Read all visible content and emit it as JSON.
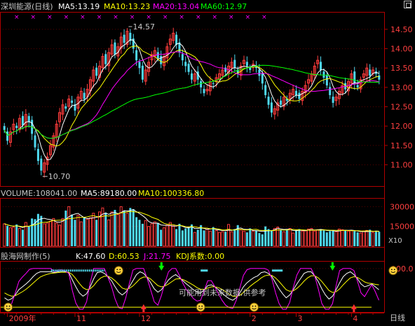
{
  "colors": {
    "bg": "#000000",
    "frame": "#b00000",
    "grid": "#5a0000",
    "up": "#ff3c3c",
    "down": "#4fd9ef",
    "text": "#c8c8c8",
    "ma5": "#ffffff",
    "ma10": "#ffff00",
    "ma20": "#ff00ff",
    "ma60": "#00ff00",
    "k": "#ffffff",
    "d": "#ffff00",
    "j": "#ff00ff",
    "coef": "#ffff00"
  },
  "header": {
    "title": "深圳能源(日线)",
    "ma5": "MA5:13.19",
    "ma10": "MA10:13.23",
    "ma20": "MA20:13.04",
    "ma60": "MA60:12.97"
  },
  "price_annotations": {
    "high": "14.57",
    "low": "10.70"
  },
  "volume_header": {
    "volume": "VOLUME:108041.00",
    "ma5": "MA5:89180.00",
    "ma10": "MA10:100336.80"
  },
  "volume_unit": "X10",
  "kdj_header": {
    "name": "股海网制作(5)",
    "k": "K:47.60",
    "d": "D:60.53",
    "j": "J:21.75",
    "coef": "KDJ系数:0.00"
  },
  "kdj_note": "可能用到未来数据,供参考",
  "period_tab": "日线",
  "chart_data": [
    {
      "type": "candlestick",
      "title": "深圳能源(日线)",
      "y_ticks": [
        11.0,
        11.5,
        12.0,
        12.5,
        13.0,
        13.5,
        14.0,
        14.5
      ],
      "ylim": [
        10.45,
        14.95
      ],
      "close_series": [
        11.9,
        11.62,
        11.85,
        12.05,
        11.95,
        12.2,
        12.02,
        12.3,
        12.1,
        11.8,
        11.45,
        11.1,
        10.85,
        11.05,
        11.2,
        11.5,
        11.75,
        12.05,
        12.35,
        12.55,
        12.45,
        12.7,
        12.6,
        12.4,
        12.75,
        12.9,
        12.7,
        12.95,
        13.2,
        13.45,
        13.3,
        13.55,
        13.8,
        13.6,
        13.9,
        14.1,
        13.85,
        14.05,
        14.3,
        14.15,
        14.45,
        14.2,
        14.0,
        13.7,
        13.5,
        13.2,
        13.45,
        13.65,
        13.85,
        13.95,
        13.75,
        13.6,
        13.8,
        14.05,
        14.25,
        14.4,
        14.1,
        13.9,
        13.7,
        13.55,
        13.4,
        13.2,
        13.35,
        13.2,
        13.0,
        12.85,
        12.95,
        13.15,
        13.1,
        13.25,
        13.35,
        13.45,
        13.4,
        13.55,
        13.65,
        13.5,
        13.35,
        13.55,
        13.7,
        13.55,
        13.45,
        13.6,
        13.5,
        13.3,
        13.1,
        12.8,
        12.55,
        12.35,
        12.45,
        12.6,
        12.55,
        12.75,
        12.65,
        12.85,
        12.95,
        12.8,
        12.7,
        12.9,
        13.05,
        13.2,
        13.35,
        13.55,
        13.7,
        13.45,
        13.25,
        13.05,
        12.8,
        12.6,
        12.75,
        12.9,
        13.05,
        12.95,
        13.15,
        13.35,
        13.1,
        13.0,
        13.2,
        13.35,
        13.5,
        13.3,
        13.45,
        13.35,
        13.2
      ]
    },
    {
      "type": "bar",
      "title": "VOLUME",
      "y_ticks": [
        15000,
        30000
      ],
      "ylim": [
        0,
        36000
      ],
      "values": [
        17000,
        15500,
        14000,
        14500,
        16500,
        13500,
        12500,
        18000,
        15000,
        21000,
        20500,
        24500,
        23000,
        17000,
        17500,
        19000,
        21000,
        17500,
        16000,
        21000,
        27000,
        30000,
        24000,
        20000,
        23500,
        18500,
        22000,
        20500,
        21500,
        25000,
        20000,
        26000,
        29000,
        25500,
        20000,
        26000,
        27500,
        24000,
        30000,
        27000,
        25000,
        29000,
        28000,
        22000,
        20000,
        17000,
        19500,
        15000,
        17000,
        18500,
        17500,
        12500,
        14000,
        16000,
        18000,
        15500,
        13000,
        17000,
        12000,
        13500,
        14500,
        16500,
        10500,
        12500,
        16000,
        12000,
        13000,
        11500,
        14500,
        12000,
        10500,
        11000,
        11000,
        16500,
        11000,
        13000,
        16000,
        12500,
        11500,
        10500,
        13500,
        11500,
        12000,
        10000,
        9000,
        15000,
        13000,
        12000,
        13500,
        14500,
        12500,
        11000,
        12500,
        13500,
        10000,
        12000,
        13000,
        11500,
        12000,
        13000,
        13500,
        11500,
        12500,
        13000,
        12000,
        10500,
        11500,
        12000,
        11000,
        13000,
        12500,
        12000,
        11500,
        12000,
        11500,
        10500,
        10000,
        11500,
        12000,
        12500,
        10500,
        11000,
        11000
      ]
    },
    {
      "type": "line",
      "title": "股海网制作(5)",
      "y_ticks": [
        100.0
      ],
      "series": [
        {
          "name": "K",
          "values": [
            28,
            22,
            26,
            35,
            48,
            55,
            62,
            70,
            80,
            88,
            92,
            92,
            92,
            92,
            90,
            92,
            93,
            92,
            90,
            72,
            55,
            40,
            32,
            38,
            55,
            75,
            90,
            92,
            88,
            80,
            70,
            55,
            42,
            35,
            42,
            55,
            70,
            85,
            92,
            88,
            78,
            65,
            50,
            42,
            48,
            60,
            72,
            80,
            85,
            78,
            70,
            62,
            55,
            48,
            42,
            40,
            48,
            58,
            60,
            55,
            48,
            40,
            32,
            26,
            22,
            28,
            40,
            55,
            65,
            72,
            78,
            82,
            90,
            92,
            88,
            80,
            65,
            50,
            38,
            28,
            35,
            48,
            62,
            75,
            88,
            92,
            92,
            82,
            68,
            50,
            35,
            25,
            32,
            48,
            65,
            80,
            88,
            92,
            85,
            75,
            62,
            55,
            58,
            62,
            55,
            48
          ]
        },
        {
          "name": "D",
          "values": [
            40,
            35,
            32,
            33,
            38,
            43,
            49,
            56,
            64,
            72,
            79,
            83,
            86,
            88,
            89,
            90,
            91,
            91,
            91,
            85,
            75,
            63,
            53,
            48,
            50,
            58,
            69,
            77,
            81,
            81,
            77,
            70,
            61,
            52,
            49,
            51,
            57,
            66,
            75,
            79,
            79,
            74,
            66,
            58,
            55,
            57,
            62,
            68,
            74,
            75,
            73,
            69,
            64,
            59,
            53,
            49,
            49,
            52,
            55,
            55,
            53,
            49,
            43,
            37,
            32,
            31,
            34,
            41,
            49,
            57,
            64,
            70,
            77,
            82,
            84,
            83,
            77,
            68,
            58,
            48,
            44,
            45,
            51,
            59,
            69,
            77,
            82,
            82,
            77,
            68,
            57,
            46,
            41,
            43,
            50,
            60,
            69,
            77,
            80,
            78,
            73,
            67,
            64,
            63,
            61,
            60
          ]
        },
        {
          "name": "J",
          "values": [
            5,
            0,
            14,
            40,
            68,
            79,
            88,
            98,
            100,
            100,
            100,
            100,
            100,
            100,
            92,
            96,
            97,
            94,
            88,
            46,
            15,
            0,
            0,
            18,
            65,
            100,
            100,
            100,
            100,
            78,
            56,
            25,
            4,
            1,
            28,
            63,
            96,
            100,
            100,
            100,
            76,
            47,
            18,
            10,
            34,
            66,
            92,
            100,
            100,
            84,
            64,
            48,
            37,
            26,
            20,
            22,
            46,
            70,
            70,
            55,
            38,
            22,
            10,
            4,
            2,
            22,
            52,
            83,
            97,
            100,
            100,
            100,
            100,
            100,
            96,
            74,
            41,
            14,
            0,
            0,
            17,
            54,
            84,
            100,
            100,
            100,
            100,
            82,
            50,
            14,
            0,
            0,
            14,
            58,
            95,
            100,
            100,
            100,
            95,
            69,
            40,
            31,
            46,
            60,
            43,
            22
          ]
        }
      ]
    }
  ],
  "x_axis": {
    "labels": [
      {
        "text": "2009年",
        "i": 1
      },
      {
        "text": "11",
        "i": 23
      },
      {
        "text": "12",
        "i": 44
      },
      {
        "text": "2",
        "i": 80
      },
      {
        "text": "3",
        "i": 95
      },
      {
        "text": "4",
        "i": 113
      }
    ]
  },
  "kdj_markers": {
    "smiley_bottoms": [
      1,
      55,
      70
    ],
    "smiley_tops": [
      32,
      109
    ],
    "down_arrows": [
      44,
      92
    ],
    "up_arrows": [
      39,
      98
    ]
  },
  "top_cross_marks": "××××××××××××××××"
}
